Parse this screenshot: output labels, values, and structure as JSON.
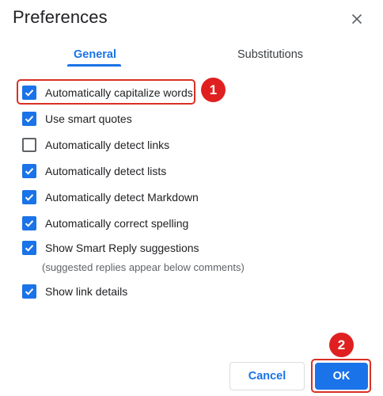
{
  "dialog": {
    "title": "Preferences",
    "close_icon": "close-icon"
  },
  "tabs": [
    {
      "label": "General",
      "active": true
    },
    {
      "label": "Substitutions",
      "active": false
    }
  ],
  "options": [
    {
      "label": "Automatically capitalize words",
      "checked": true
    },
    {
      "label": "Use smart quotes",
      "checked": true
    },
    {
      "label": "Automatically detect links",
      "checked": false
    },
    {
      "label": "Automatically detect lists",
      "checked": true
    },
    {
      "label": "Automatically detect Markdown",
      "checked": true
    },
    {
      "label": "Automatically correct spelling",
      "checked": true
    },
    {
      "label": "Show Smart Reply suggestions",
      "checked": true,
      "hint": "(suggested replies appear below comments)"
    },
    {
      "label": "Show link details",
      "checked": true
    }
  ],
  "annotations": [
    "1",
    "2"
  ],
  "buttons": {
    "cancel": "Cancel",
    "ok": "OK"
  },
  "colors": {
    "accent": "#1a73e8",
    "annotation": "#e02020"
  }
}
